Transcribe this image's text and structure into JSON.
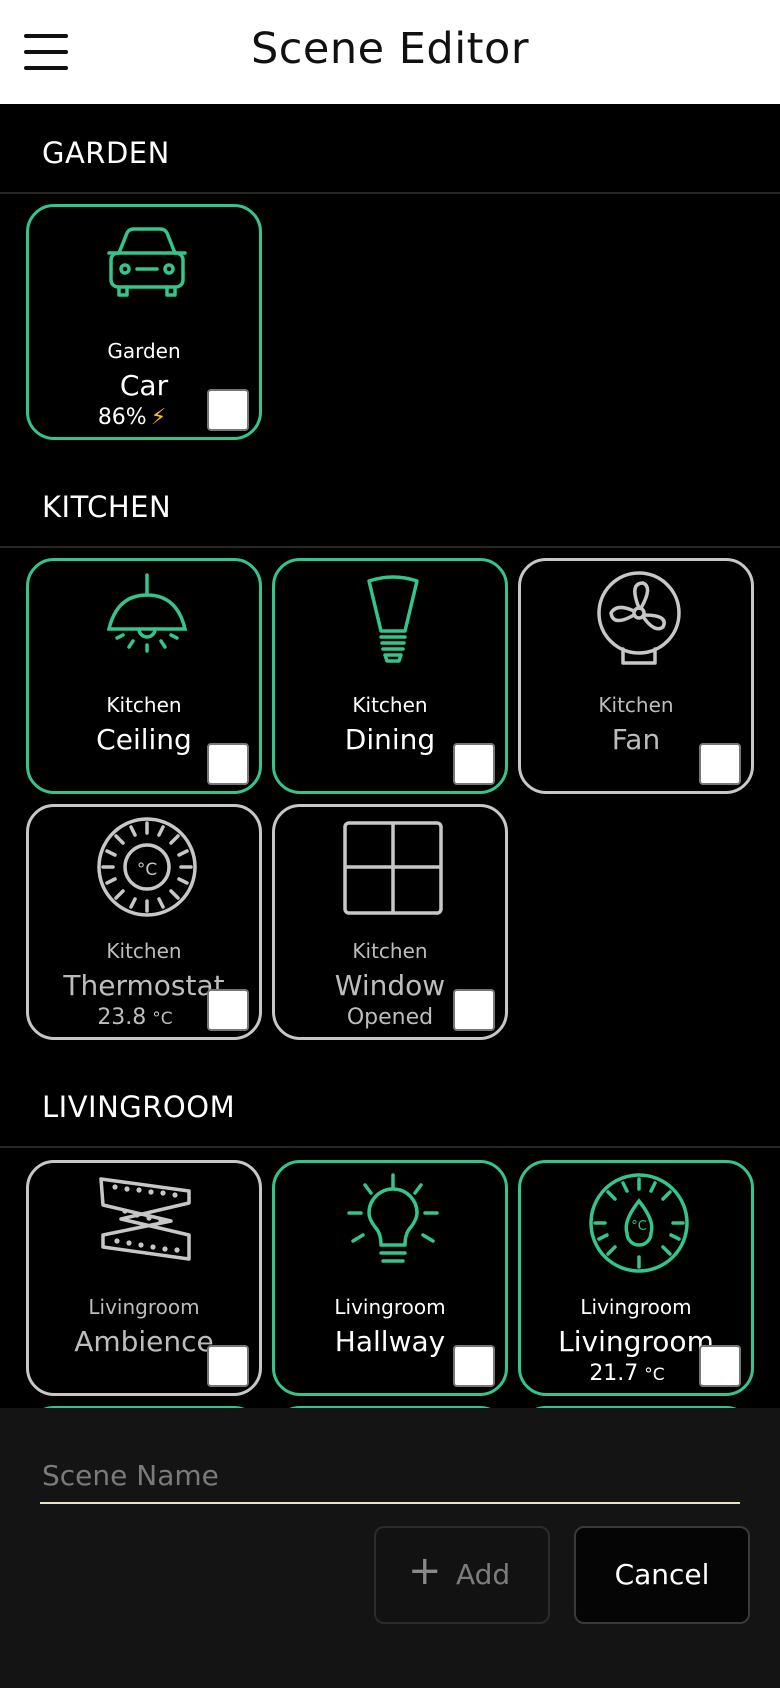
{
  "app": {
    "title": "Scene Editor"
  },
  "colors": {
    "active": "#33c58c",
    "inactive": "#c7c7c7",
    "background": "#000000",
    "bolt": "#f2c21b"
  },
  "sections": [
    {
      "label": "GARDEN",
      "tiles": [
        {
          "room": "Garden",
          "name": "Car",
          "status": "86%",
          "icon": "car-icon",
          "active": true,
          "checked": false
        }
      ]
    },
    {
      "label": "KITCHEN",
      "tiles": [
        {
          "room": "Kitchen",
          "name": "Ceiling",
          "icon": "ceiling-lamp-icon",
          "active": true,
          "checked": false
        },
        {
          "room": "Kitchen",
          "name": "Dining",
          "icon": "bulb-spot-icon",
          "active": true,
          "checked": false
        },
        {
          "room": "Kitchen",
          "name": "Fan",
          "icon": "fan-icon",
          "active": false,
          "checked": false
        },
        {
          "room": "Kitchen",
          "name": "Thermostat",
          "status": "23.8",
          "unit": "°C",
          "icon": "thermostat-icon",
          "active": false,
          "checked": false
        },
        {
          "room": "Kitchen",
          "name": "Window",
          "status": "Opened",
          "icon": "window-icon",
          "active": false,
          "checked": false
        }
      ]
    },
    {
      "label": "LIVINGROOM",
      "tiles": [
        {
          "room": "Livingroom",
          "name": "Ambience",
          "icon": "led-strip-icon",
          "active": false,
          "checked": false
        },
        {
          "room": "Livingroom",
          "name": "Hallway",
          "icon": "bulb-icon",
          "active": true,
          "checked": false
        },
        {
          "room": "Livingroom",
          "name": "Livingroom",
          "status": "21.7",
          "unit": "°C",
          "icon": "thermostat-icon",
          "active": true,
          "checked": false
        }
      ]
    }
  ],
  "scene_name": {
    "placeholder": "Scene Name",
    "value": ""
  },
  "buttons": {
    "add": "Add",
    "cancel": "Cancel"
  }
}
